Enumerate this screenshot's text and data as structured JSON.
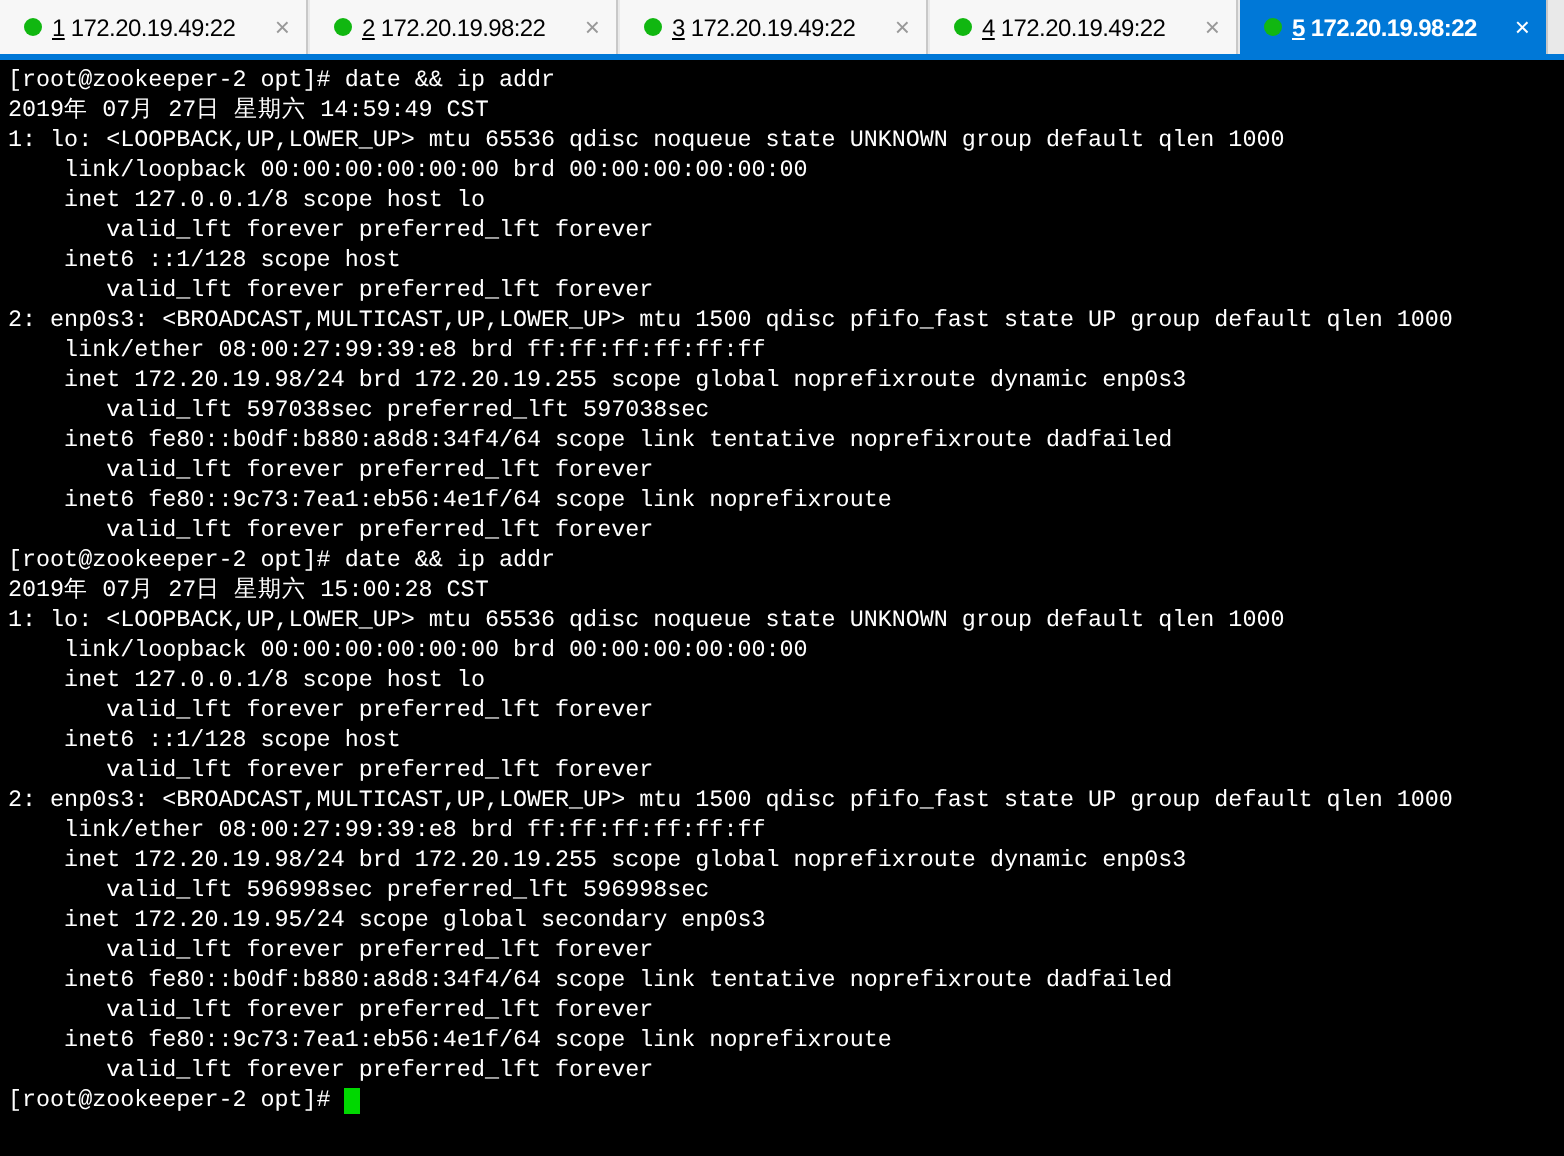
{
  "tabs": [
    {
      "number": "1",
      "host": "172.20.19.49:22",
      "close": "×",
      "selected": false
    },
    {
      "number": "2",
      "host": "172.20.19.98:22",
      "close": "×",
      "selected": false
    },
    {
      "number": "3",
      "host": "172.20.19.49:22",
      "close": "×",
      "selected": false
    },
    {
      "number": "4",
      "host": "172.20.19.49:22",
      "close": "×",
      "selected": false
    },
    {
      "number": "5",
      "host": "172.20.19.98:22",
      "close": "×",
      "selected": true
    }
  ],
  "terminal": {
    "lines": [
      "[root@zookeeper-2 opt]# date && ip addr",
      "2019年 07月 27日 星期六 14:59:49 CST",
      "1: lo: <LOOPBACK,UP,LOWER_UP> mtu 65536 qdisc noqueue state UNKNOWN group default qlen 1000",
      "    link/loopback 00:00:00:00:00:00 brd 00:00:00:00:00:00",
      "    inet 127.0.0.1/8 scope host lo",
      "       valid_lft forever preferred_lft forever",
      "    inet6 ::1/128 scope host",
      "       valid_lft forever preferred_lft forever",
      "2: enp0s3: <BROADCAST,MULTICAST,UP,LOWER_UP> mtu 1500 qdisc pfifo_fast state UP group default qlen 1000",
      "    link/ether 08:00:27:99:39:e8 brd ff:ff:ff:ff:ff:ff",
      "    inet 172.20.19.98/24 brd 172.20.19.255 scope global noprefixroute dynamic enp0s3",
      "       valid_lft 597038sec preferred_lft 597038sec",
      "    inet6 fe80::b0df:b880:a8d8:34f4/64 scope link tentative noprefixroute dadfailed",
      "       valid_lft forever preferred_lft forever",
      "    inet6 fe80::9c73:7ea1:eb56:4e1f/64 scope link noprefixroute",
      "       valid_lft forever preferred_lft forever",
      "[root@zookeeper-2 opt]# date && ip addr",
      "2019年 07月 27日 星期六 15:00:28 CST",
      "1: lo: <LOOPBACK,UP,LOWER_UP> mtu 65536 qdisc noqueue state UNKNOWN group default qlen 1000",
      "    link/loopback 00:00:00:00:00:00 brd 00:00:00:00:00:00",
      "    inet 127.0.0.1/8 scope host lo",
      "       valid_lft forever preferred_lft forever",
      "    inet6 ::1/128 scope host",
      "       valid_lft forever preferred_lft forever",
      "2: enp0s3: <BROADCAST,MULTICAST,UP,LOWER_UP> mtu 1500 qdisc pfifo_fast state UP group default qlen 1000",
      "    link/ether 08:00:27:99:39:e8 brd ff:ff:ff:ff:ff:ff",
      "    inet 172.20.19.98/24 brd 172.20.19.255 scope global noprefixroute dynamic enp0s3",
      "       valid_lft 596998sec preferred_lft 596998sec",
      "    inet 172.20.19.95/24 scope global secondary enp0s3",
      "       valid_lft forever preferred_lft forever",
      "    inet6 fe80::b0df:b880:a8d8:34f4/64 scope link tentative noprefixroute dadfailed",
      "       valid_lft forever preferred_lft forever",
      "    inet6 fe80::9c73:7ea1:eb56:4e1f/64 scope link noprefixroute",
      "       valid_lft forever preferred_lft forever",
      "[root@zookeeper-2 opt]# "
    ]
  }
}
